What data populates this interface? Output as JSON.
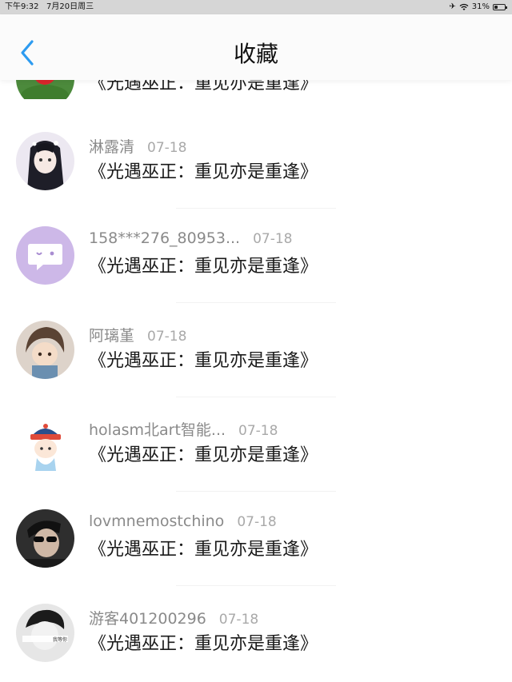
{
  "status": {
    "time": "下午9:32",
    "date": "7月20日周三",
    "battery": "31%",
    "battery_level": 0.31
  },
  "header": {
    "title": "收藏"
  },
  "partial_row": {
    "text": "《光遇巫正：重见亦是重逢》"
  },
  "rows": [
    {
      "name": "淋露清",
      "date": "07-18",
      "text": "《光遇巫正：重见亦是重逢》",
      "avatar_icon": "anime-girl-avatar",
      "avatar_color": "#e8e3ef"
    },
    {
      "name": "158***276_80953...",
      "date": "07-18",
      "text": "《光遇巫正：重见亦是重逢》",
      "avatar_icon": "chat-bubble-avatar",
      "avatar_color": "#cdb8e8"
    },
    {
      "name": "阿璃堇",
      "date": "07-18",
      "text": "《光遇巫正：重见亦是重逢》",
      "avatar_icon": "cartoon-boy-avatar",
      "avatar_color": "#d9cfc6"
    },
    {
      "name": "holasm北art智能...",
      "date": "07-18",
      "text": "《光遇巫正：重见亦是重逢》",
      "avatar_icon": "qing-official-avatar",
      "avatar_color": "#ffffff"
    },
    {
      "name": "lovmnemostchino",
      "date": "07-18",
      "text": "《光遇巫正：重见亦是重逢》",
      "avatar_icon": "sunglasses-man-avatar",
      "avatar_color": "#3b3b3b"
    },
    {
      "name": "游客401200296",
      "date": "07-18",
      "text": "《光遇巫正：重见亦是重逢》",
      "avatar_icon": "bw-boy-avatar",
      "avatar_color": "#cfcfcf",
      "avatar_caption": "我等你"
    }
  ]
}
